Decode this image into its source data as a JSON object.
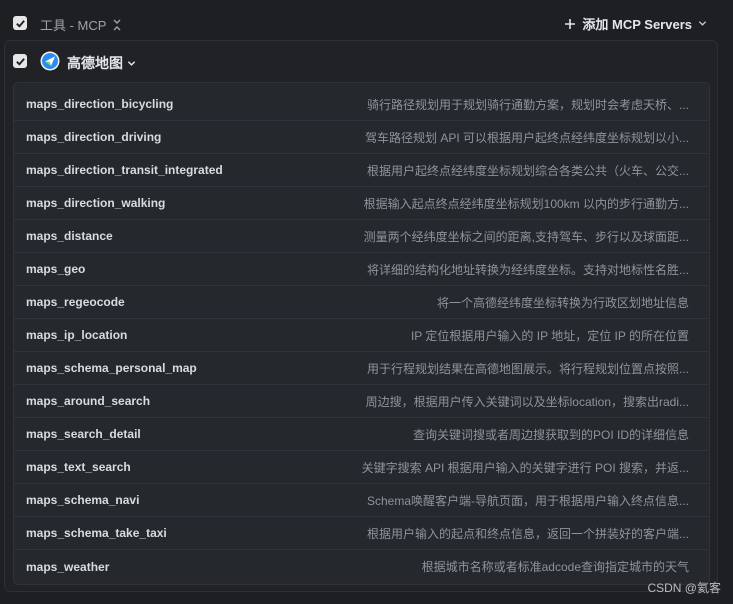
{
  "header": {
    "title": "工具 - MCP",
    "add_button_label": "添加 MCP Servers"
  },
  "server": {
    "name": "高德地图",
    "logo_color": "#2d8cf0"
  },
  "tools": [
    {
      "name": "maps_direction_bicycling",
      "desc": "骑行路径规划用于规划骑行通勤方案，规划时会考虑天桥、..."
    },
    {
      "name": "maps_direction_driving",
      "desc": "驾车路径规划 API 可以根据用户起终点经纬度坐标规划以小..."
    },
    {
      "name": "maps_direction_transit_integrated",
      "desc": "根据用户起终点经纬度坐标规划综合各类公共（火车、公交..."
    },
    {
      "name": "maps_direction_walking",
      "desc": "根据输入起点终点经纬度坐标规划100km 以内的步行通勤方..."
    },
    {
      "name": "maps_distance",
      "desc": "测量两个经纬度坐标之间的距离,支持驾车、步行以及球面距..."
    },
    {
      "name": "maps_geo",
      "desc": "将详细的结构化地址转换为经纬度坐标。支持对地标性名胜..."
    },
    {
      "name": "maps_regeocode",
      "desc": "将一个高德经纬度坐标转换为行政区划地址信息"
    },
    {
      "name": "maps_ip_location",
      "desc": "IP 定位根据用户输入的 IP 地址，定位 IP 的所在位置"
    },
    {
      "name": "maps_schema_personal_map",
      "desc": "用于行程规划结果在高德地图展示。将行程规划位置点按照..."
    },
    {
      "name": "maps_around_search",
      "desc": "周边搜，根据用户传入关键词以及坐标location，搜索出radi..."
    },
    {
      "name": "maps_search_detail",
      "desc": "查询关键词搜或者周边搜获取到的POI ID的详细信息"
    },
    {
      "name": "maps_text_search",
      "desc": "关键字搜索 API 根据用户输入的关键字进行 POI 搜索，并返..."
    },
    {
      "name": "maps_schema_navi",
      "desc": "Schema唤醒客户端-导航页面，用于根据用户输入终点信息..."
    },
    {
      "name": "maps_schema_take_taxi",
      "desc": "根据用户输入的起点和终点信息，返回一个拼装好的客户端..."
    },
    {
      "name": "maps_weather",
      "desc": "根据城市名称或者标准adcode查询指定城市的天气"
    }
  ],
  "watermark": "CSDN @氦客"
}
